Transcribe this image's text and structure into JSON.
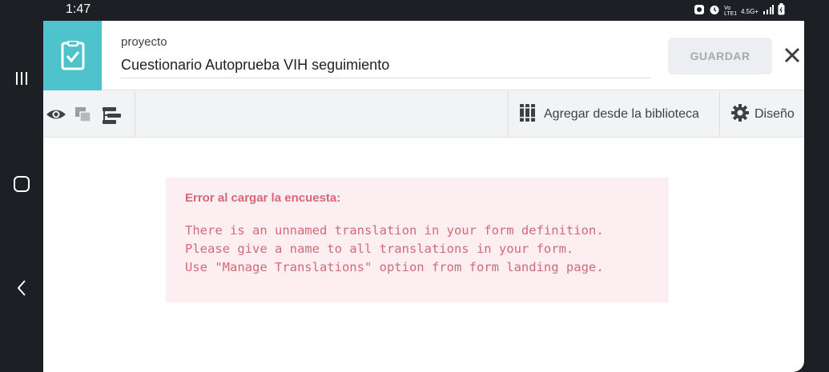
{
  "status_bar": {
    "time": "1:47",
    "network": "4.5G+",
    "sim": "Vo LTE1"
  },
  "nav_bar": {
    "icons": [
      "recents-icon",
      "home-icon",
      "back-icon"
    ]
  },
  "header": {
    "project_label": "proyecto",
    "project_name": "Cuestionario Autoprueba VIH seguimiento",
    "save_label": "GUARDAR",
    "logo_color": "#4fc3cc"
  },
  "toolbar": {
    "library_label": "Agregar desde la biblioteca",
    "design_label": "Diseño"
  },
  "error": {
    "title": "Error al cargar la encuesta:",
    "message": "There is an unnamed translation in your form definition.\nPlease give a name to all translations in your form.\nUse \"Manage Translations\" option from form landing page.",
    "text_color": "#d26a79",
    "background": "#fdeff1"
  }
}
